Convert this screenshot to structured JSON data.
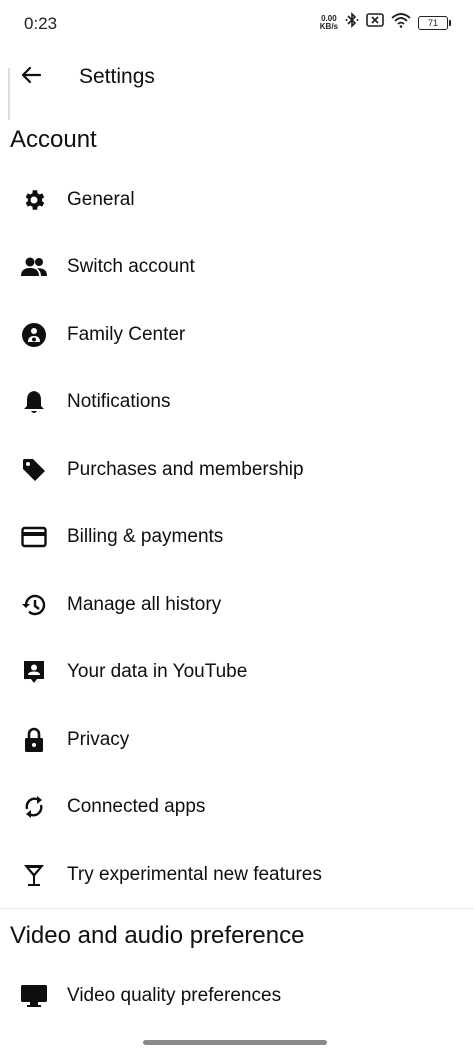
{
  "status_bar": {
    "time": "0:23",
    "net_speed_value": "0.00",
    "net_speed_unit": "KB/s",
    "battery": "71"
  },
  "app_bar": {
    "title": "Settings"
  },
  "sections": {
    "account": {
      "header": "Account",
      "items": [
        {
          "label": "General",
          "icon": "gear-icon"
        },
        {
          "label": "Switch account",
          "icon": "people-icon"
        },
        {
          "label": "Family Center",
          "icon": "family-icon"
        },
        {
          "label": "Notifications",
          "icon": "bell-icon"
        },
        {
          "label": "Purchases and membership",
          "icon": "tag-icon"
        },
        {
          "label": "Billing & payments",
          "icon": "credit-card-icon"
        },
        {
          "label": "Manage all history",
          "icon": "history-icon"
        },
        {
          "label": "Your data in YouTube",
          "icon": "account-box-icon"
        },
        {
          "label": "Privacy",
          "icon": "lock-icon"
        },
        {
          "label": "Connected apps",
          "icon": "sync-icon"
        },
        {
          "label": "Try experimental new features",
          "icon": "glass-icon"
        }
      ]
    },
    "video_audio": {
      "header": "Video and audio preference",
      "items": [
        {
          "label": "Video quality preferences",
          "icon": "monitor-icon"
        }
      ]
    }
  }
}
